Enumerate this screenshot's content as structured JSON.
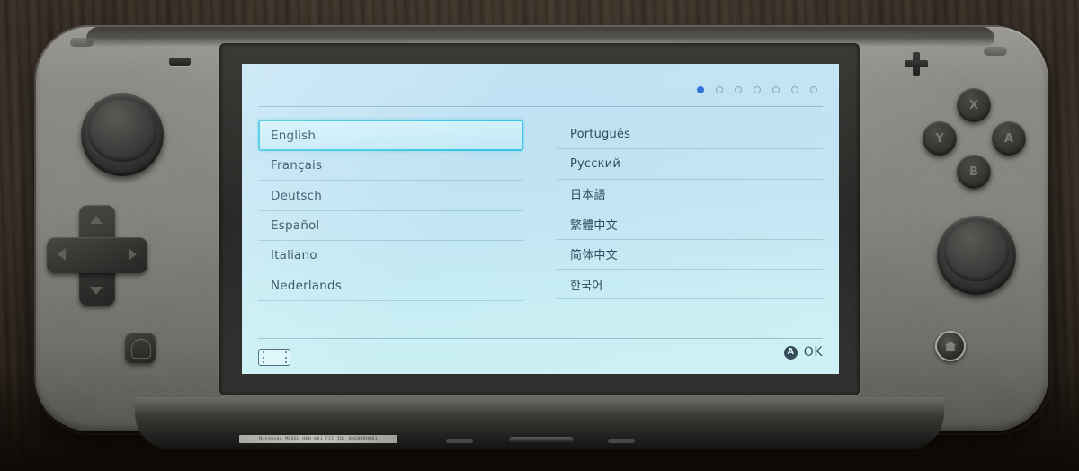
{
  "scene": {
    "device_name": "Nintendo Switch Lite handheld console",
    "surface": "dark wood table"
  },
  "screen": {
    "title_visible": false,
    "pager": {
      "total": 7,
      "active_index": 0,
      "dots": [
        "active",
        "inactive",
        "inactive",
        "inactive",
        "inactive",
        "inactive",
        "inactive"
      ]
    },
    "languages": {
      "left_column": [
        {
          "label": "English",
          "selected": true
        },
        {
          "label": "Français",
          "selected": false
        },
        {
          "label": "Deutsch",
          "selected": false
        },
        {
          "label": "Español",
          "selected": false
        },
        {
          "label": "Italiano",
          "selected": false
        },
        {
          "label": "Nederlands",
          "selected": false
        }
      ],
      "right_column": [
        {
          "label": "Português",
          "selected": false
        },
        {
          "label": "Русский",
          "selected": false
        },
        {
          "label": "日本語",
          "selected": false
        },
        {
          "label": "繁體中文",
          "selected": false
        },
        {
          "label": "简体中文",
          "selected": false
        },
        {
          "label": "한국어",
          "selected": false
        }
      ]
    },
    "footer": {
      "console_icon": "switch-console-icon",
      "button_glyph": "A",
      "confirm_label": "OK"
    },
    "colors": {
      "screen_top": "#c2e3f4",
      "screen_bottom": "#cbf1f4",
      "text": "#2a4a5c",
      "selection_border": "#39c6e3",
      "pager_active": "#2f6fd8",
      "divider": "#6e96af"
    }
  },
  "hardware": {
    "left": {
      "minus_button": "minus-button",
      "analog_stick": "left-analog-stick",
      "dpad": "dpad",
      "capture_button": "capture-button"
    },
    "right": {
      "plus_button": "plus-button",
      "face_buttons": [
        {
          "label": "X"
        },
        {
          "label": "Y"
        },
        {
          "label": "A"
        },
        {
          "label": "B"
        }
      ],
      "analog_stick": "right-analog-stick",
      "home_button": "home-button"
    },
    "bottom": {
      "regulatory_label": "Nintendo  MODEL HDH-001  FCC ID: BKENHDH001",
      "usb_port": "usb-c-port",
      "speakers": [
        "speaker-left",
        "speaker-right"
      ]
    }
  }
}
